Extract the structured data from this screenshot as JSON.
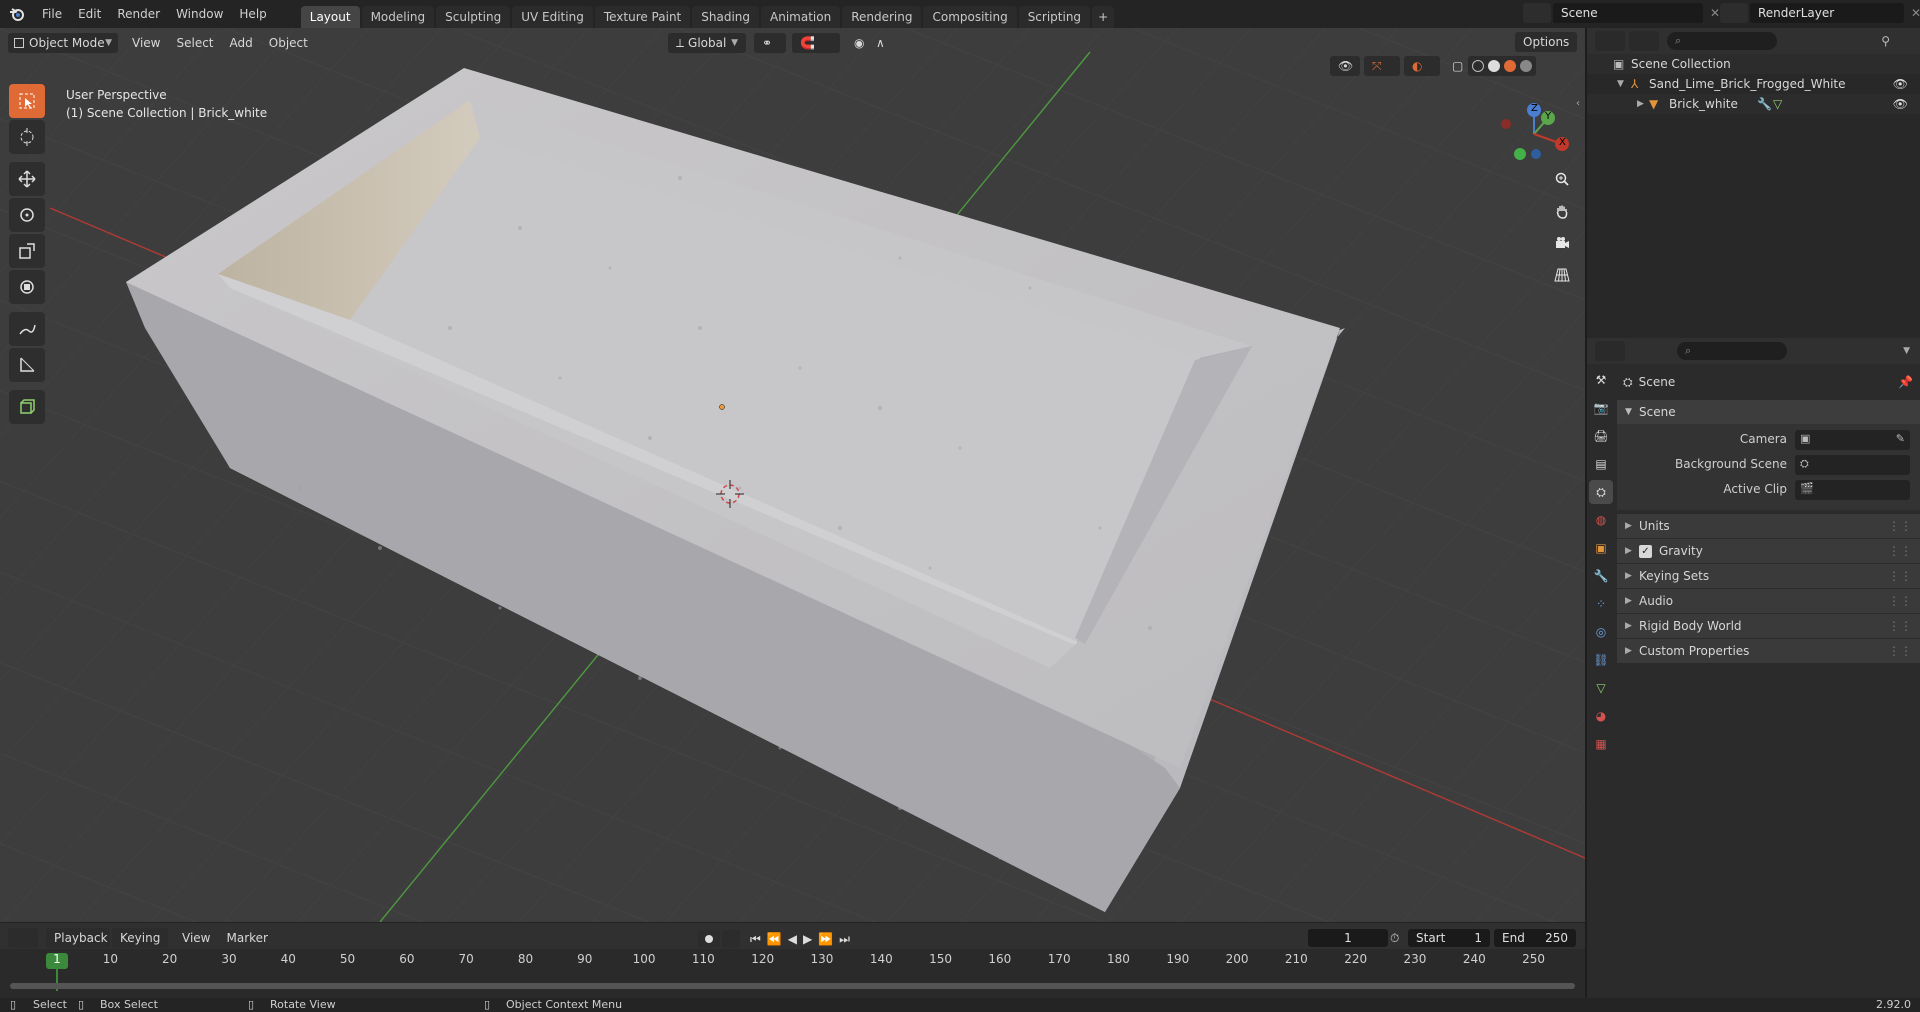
{
  "topbar": {
    "menus": [
      "File",
      "Edit",
      "Render",
      "Window",
      "Help"
    ],
    "workspaces": [
      "Layout",
      "Modeling",
      "Sculpting",
      "UV Editing",
      "Texture Paint",
      "Shading",
      "Animation",
      "Rendering",
      "Compositing",
      "Scripting"
    ],
    "active_workspace": "Layout",
    "scene_name": "Scene",
    "render_layer": "RenderLayer"
  },
  "viewport": {
    "mode": "Object Mode",
    "header_menus": [
      "View",
      "Select",
      "Add",
      "Object"
    ],
    "transform_orientation": "Global",
    "options_label": "Options",
    "view_name": "User Perspective",
    "collection_info": "(1) Scene Collection | Brick_white",
    "gizmo_labels": {
      "z": "Z",
      "y": "Y",
      "x": "X"
    }
  },
  "outliner": {
    "root": "Scene Collection",
    "items": [
      {
        "label": "Sand_Lime_Brick_Frogged_White"
      },
      {
        "label": "Brick_white"
      }
    ]
  },
  "properties": {
    "context": "Scene",
    "panel_title": "Scene",
    "fields": [
      {
        "label": "Camera"
      },
      {
        "label": "Background Scene"
      },
      {
        "label": "Active Clip"
      }
    ],
    "subpanels": [
      "Units",
      "Gravity",
      "Keying Sets",
      "Audio",
      "Rigid Body World",
      "Custom Properties"
    ],
    "gravity_checked": true
  },
  "timeline": {
    "menus": [
      "Playback",
      "Keying",
      "View",
      "Marker"
    ],
    "current_frame": "1",
    "start_label": "Start",
    "start_value": "1",
    "end_label": "End",
    "end_value": "250",
    "frames": [
      "1",
      "10",
      "20",
      "30",
      "40",
      "50",
      "60",
      "70",
      "80",
      "90",
      "100",
      "110",
      "120",
      "130",
      "140",
      "150",
      "160",
      "170",
      "180",
      "190",
      "200",
      "210",
      "220",
      "230",
      "240",
      "250"
    ]
  },
  "statusbar": {
    "select": "Select",
    "box_select": "Box Select",
    "rotate_view": "Rotate View",
    "context_menu": "Object Context Menu",
    "version": "2.92.0"
  },
  "colors": {
    "accent": "#e06a36",
    "x_axis": "#c0392b",
    "y_axis": "#5ba64b",
    "z_axis": "#4a7fd0"
  }
}
